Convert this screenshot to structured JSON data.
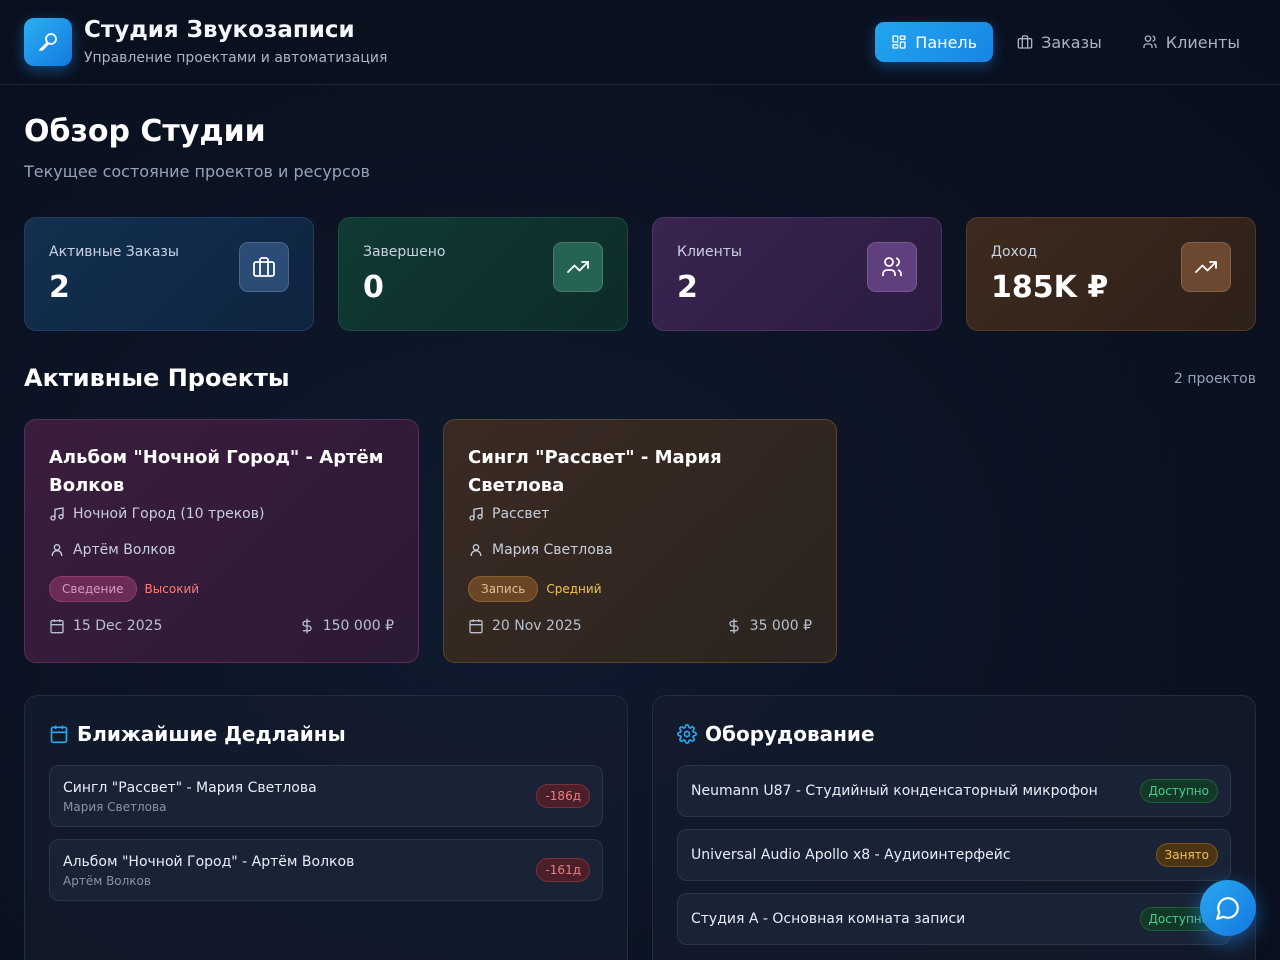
{
  "header": {
    "title": "Студия Звукозаписи",
    "subtitle": "Управление проектами и автоматизация",
    "nav": [
      {
        "label": "Панель",
        "icon": "grid-icon",
        "active": true
      },
      {
        "label": "Заказы",
        "icon": "briefcase-icon",
        "active": false
      },
      {
        "label": "Клиенты",
        "icon": "users-icon",
        "active": false
      }
    ]
  },
  "page": {
    "title": "Обзор Студии",
    "subtitle": "Текущее состояние проектов и ресурсов"
  },
  "stats": [
    {
      "label": "Активные Заказы",
      "value": "2",
      "icon": "briefcase-icon",
      "color": "#2b4c74"
    },
    {
      "label": "Завершено",
      "value": "0",
      "icon": "trending-up-icon",
      "color": "#266353"
    },
    {
      "label": "Клиенты",
      "value": "2",
      "icon": "users-icon",
      "color": "#5f3f7d"
    },
    {
      "label": "Доход",
      "value": "185K ₽",
      "icon": "trending-up-icon",
      "color": "#6c4830"
    }
  ],
  "projects_section": {
    "title": "Активные Проекты",
    "count": "2 проектов",
    "items": [
      {
        "title": "Альбом \"Ночной Город\" - Артём Волков",
        "track": "Ночной Город (10 треков)",
        "client": "Артём Волков",
        "status": "Сведение",
        "priority": "Высокий",
        "date": "15 Dec 2025",
        "price": "150 000 ₽"
      },
      {
        "title": "Сингл \"Рассвет\" - Мария Светлова",
        "track": "Рассвет",
        "client": "Мария Светлова",
        "status": "Запись",
        "priority": "Средний",
        "date": "20 Nov 2025",
        "price": "35 000 ₽"
      }
    ]
  },
  "deadlines": {
    "title": "Ближайшие Дедлайны",
    "items": [
      {
        "title": "Сингл \"Рассвет\" - Мария Светлова",
        "client": "Мария Светлова",
        "days": "-186д"
      },
      {
        "title": "Альбом \"Ночной Город\" - Артём Волков",
        "client": "Артём Волков",
        "days": "-161д"
      }
    ]
  },
  "equipment": {
    "title": "Оборудование",
    "items": [
      {
        "name": "Neumann U87 - Студийный конденсаторный микрофон",
        "status": "Доступно",
        "state": "free"
      },
      {
        "name": "Universal Audio Apollo x8 - Аудиоинтерфейс",
        "status": "Занято",
        "state": "busy"
      },
      {
        "name": "Студия А - Основная комната записи",
        "status": "Доступно",
        "state": "free"
      }
    ]
  },
  "colors": {
    "accent": "#1f95ea",
    "danger": "#f27b7b",
    "success": "#43d08a",
    "warning": "#f4c14a"
  }
}
